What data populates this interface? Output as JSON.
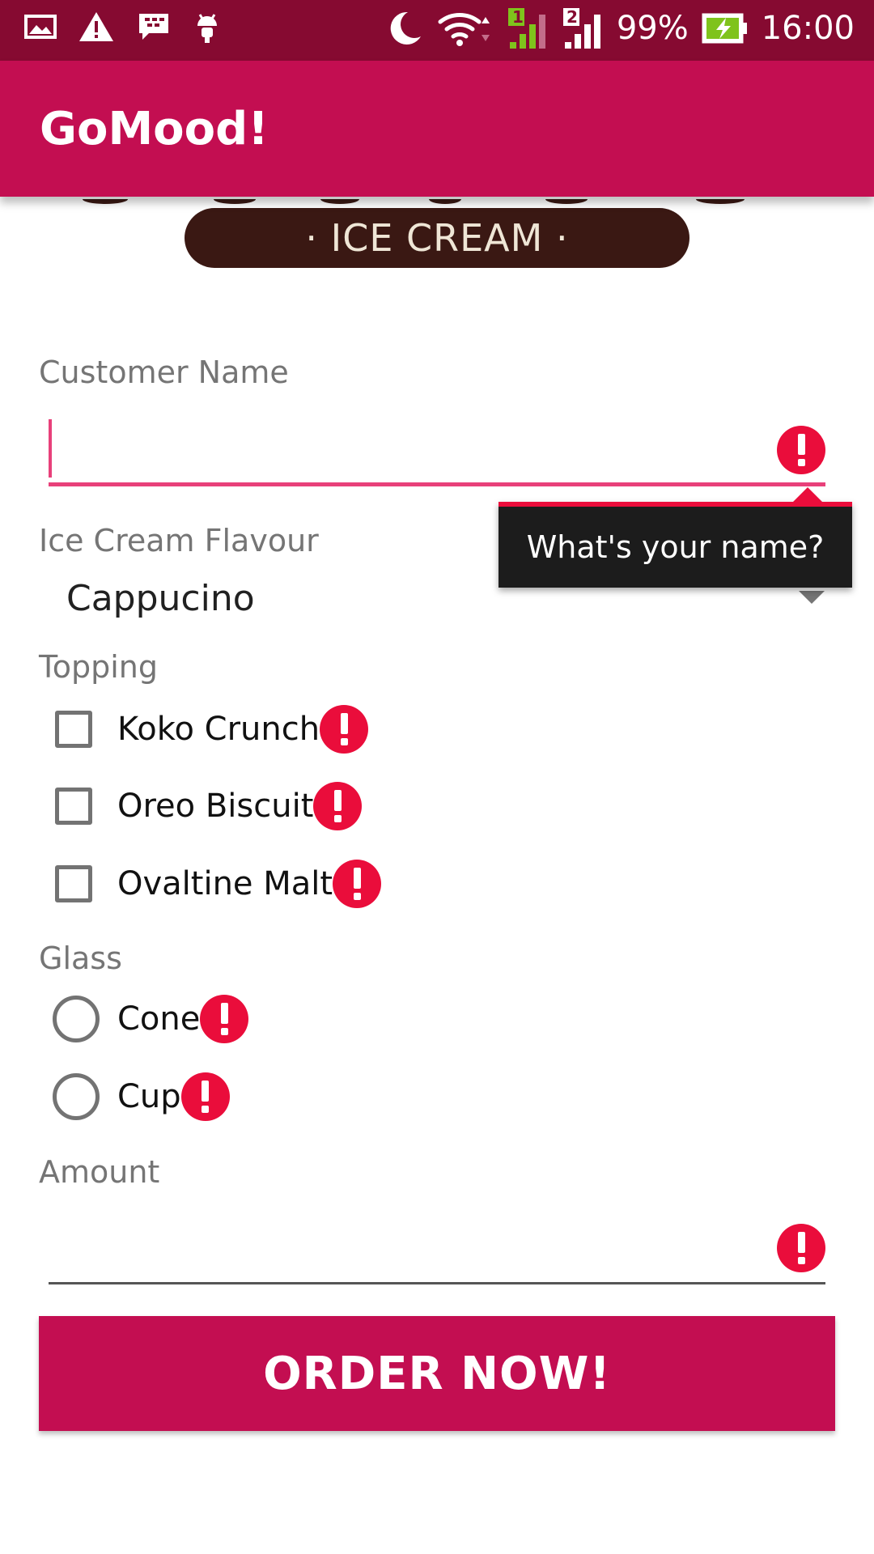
{
  "status_bar": {
    "icons": [
      "image-icon",
      "warning-icon",
      "blackberry-messenger-icon",
      "android-icon",
      "moon-icon",
      "wifi-icon",
      "signal-sim1-icon",
      "signal-sim2-icon",
      "battery-charging-icon"
    ],
    "battery": "99%",
    "time": "16:00",
    "sim1": "1",
    "sim2": "2"
  },
  "app_bar": {
    "title": "GoMood!"
  },
  "banner": {
    "text": "· ICE CREAM ·"
  },
  "form": {
    "customer_name": {
      "label": "Customer Name",
      "value": "",
      "error_tooltip": "What's your name?"
    },
    "flavour": {
      "label": "Ice Cream Flavour",
      "selected": "Cappucino"
    },
    "topping": {
      "label": "Topping",
      "options": [
        {
          "label": "Koko Crunch",
          "checked": false
        },
        {
          "label": "Oreo Biscuit",
          "checked": false
        },
        {
          "label": "Ovaltine Malt",
          "checked": false
        }
      ]
    },
    "glass": {
      "label": "Glass",
      "options": [
        {
          "label": "Cone",
          "selected": false
        },
        {
          "label": "Cup",
          "selected": false
        }
      ]
    },
    "amount": {
      "label": "Amount",
      "value": ""
    },
    "submit_label": "ORDER NOW!"
  },
  "colors": {
    "status_bar": "#860a31",
    "primary": "#c30e51",
    "accent": "#e8407a",
    "error": "#ea0d3b",
    "tooltip_bg": "#1c1c1c"
  }
}
